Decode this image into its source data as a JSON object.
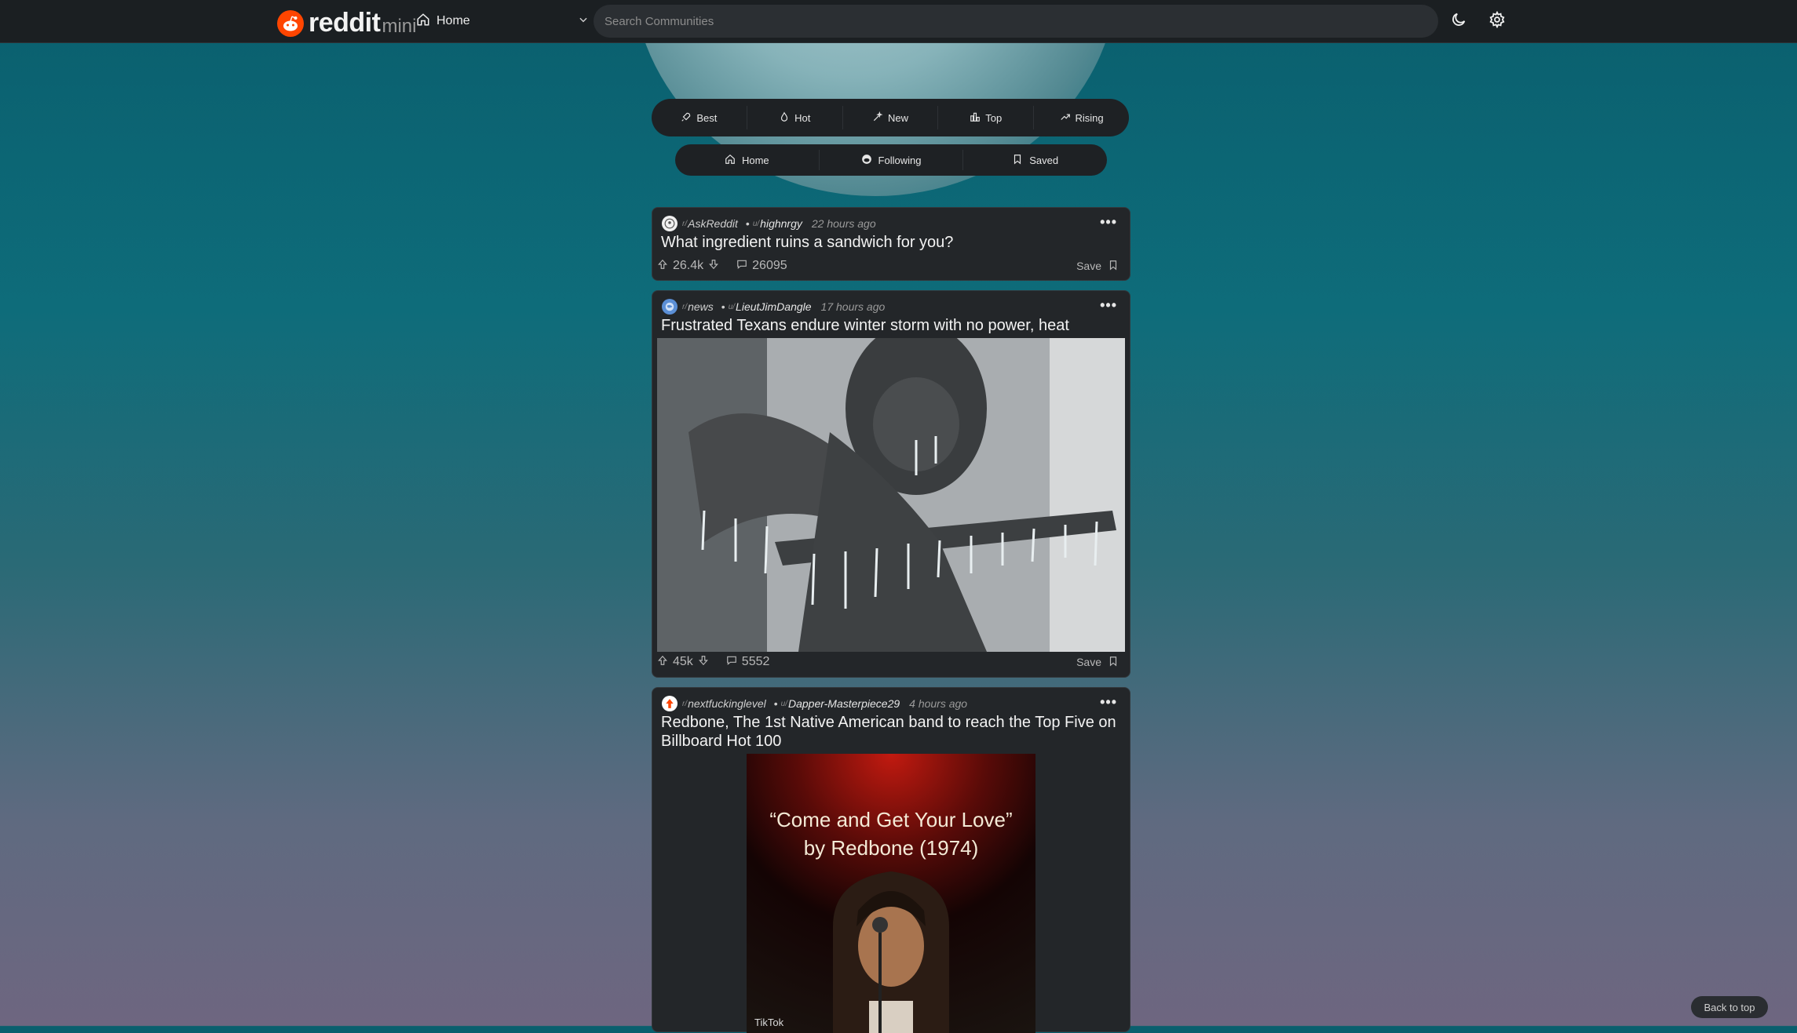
{
  "app": {
    "logo_text": "reddit",
    "logo_suffix": "mini"
  },
  "header": {
    "feed_label": "Home",
    "search_placeholder": "Search Communities"
  },
  "sort_tabs": [
    {
      "label": "Best",
      "icon": "rocket-icon"
    },
    {
      "label": "Hot",
      "icon": "flame-icon"
    },
    {
      "label": "New",
      "icon": "sparkle-icon"
    },
    {
      "label": "Top",
      "icon": "bar-chart-icon"
    },
    {
      "label": "Rising",
      "icon": "trend-up-icon"
    }
  ],
  "feed_tabs": [
    {
      "label": "Home",
      "icon": "home-icon"
    },
    {
      "label": "Following",
      "icon": "reddit-alien-icon"
    },
    {
      "label": "Saved",
      "icon": "bookmark-icon"
    }
  ],
  "posts": [
    {
      "sub_prefix": "r/",
      "subreddit": "AskReddit",
      "user_prefix": "u/",
      "user": "highnrgy",
      "time": "22 hours ago",
      "title": "What ingredient ruins a sandwich for you?",
      "votes": "26.4k",
      "comments": "26095",
      "save_label": "Save"
    },
    {
      "sub_prefix": "r/",
      "subreddit": "news",
      "user_prefix": "u/",
      "user": "LieutJimDangle",
      "time": "17 hours ago",
      "title": "Frustrated Texans endure winter storm with no power, heat",
      "votes": "45k",
      "comments": "5552",
      "save_label": "Save"
    },
    {
      "sub_prefix": "r/",
      "subreddit": "nextfuckinglevel",
      "user_prefix": "u/",
      "user": "Dapper-Masterpiece29",
      "time": "4 hours ago",
      "title": "Redbone, The 1st Native American band to reach the Top Five on Billboard Hot 100",
      "video_caption_line1": "“Come and Get Your Love”",
      "video_caption_line2": "by Redbone (1974)",
      "video_watermark": "TikTok"
    }
  ],
  "footer": {
    "back_to_top": "Back to top"
  },
  "colors": {
    "accent": "#ff4500",
    "topbar": "#1b1f22",
    "card": "#232629"
  }
}
